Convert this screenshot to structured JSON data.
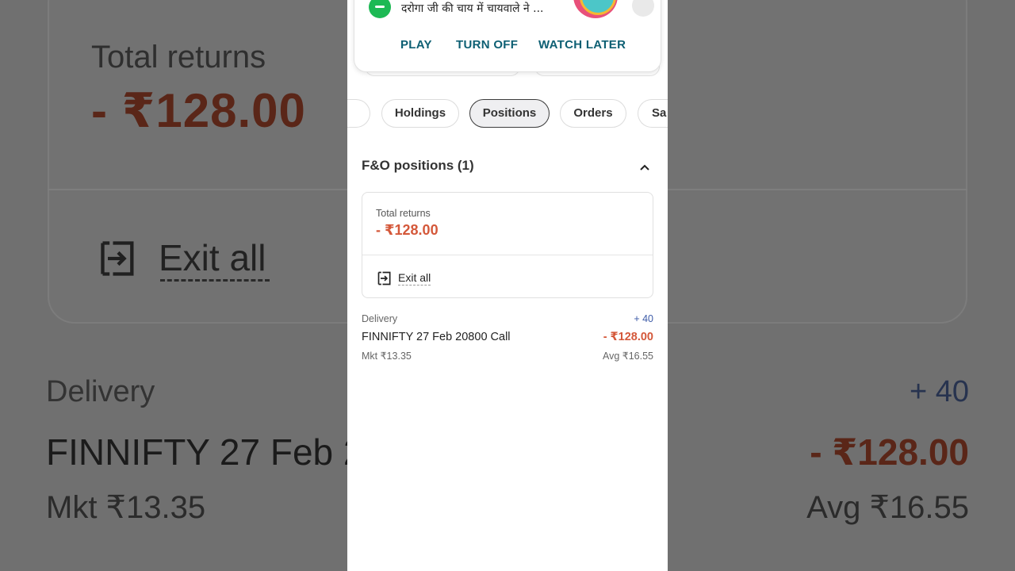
{
  "notification": {
    "text": "दरोगा जी की चाय में चायवाले ने ...",
    "actions": {
      "play": "PLAY",
      "turn_off": "TURN OFF",
      "watch_later": "WATCH LATER"
    }
  },
  "tabs": [
    {
      "label": ""
    },
    {
      "label": "Holdings"
    },
    {
      "label": "Positions",
      "active": true
    },
    {
      "label": "Orders"
    },
    {
      "label": "Sa"
    }
  ],
  "section": {
    "title": "F&O positions (1)"
  },
  "summary": {
    "label": "Total returns",
    "value": "- ₹128.00",
    "exit_label": "Exit all"
  },
  "position": {
    "type": "Delivery",
    "qty": "+ 40",
    "name": "FINNIFTY 27 Feb 20800 Call",
    "pnl": "- ₹128.00",
    "mkt": "Mkt ₹13.35",
    "avg": "Avg ₹16.55"
  },
  "colors": {
    "loss": "#d4583a",
    "qty": "#3e5ca8",
    "accent": "#0d5f73"
  },
  "background_zoom": {
    "total_label": "Total returns",
    "total_value": "- ₹128.00",
    "exit_label": "Exit all",
    "delivery": "Delivery",
    "qty": "+ 40",
    "name": "FINNIFTY 27 Feb 2",
    "pnl": "- ₹128.00",
    "mkt": "Mkt ₹13.35",
    "avg": "Avg ₹16.55"
  }
}
